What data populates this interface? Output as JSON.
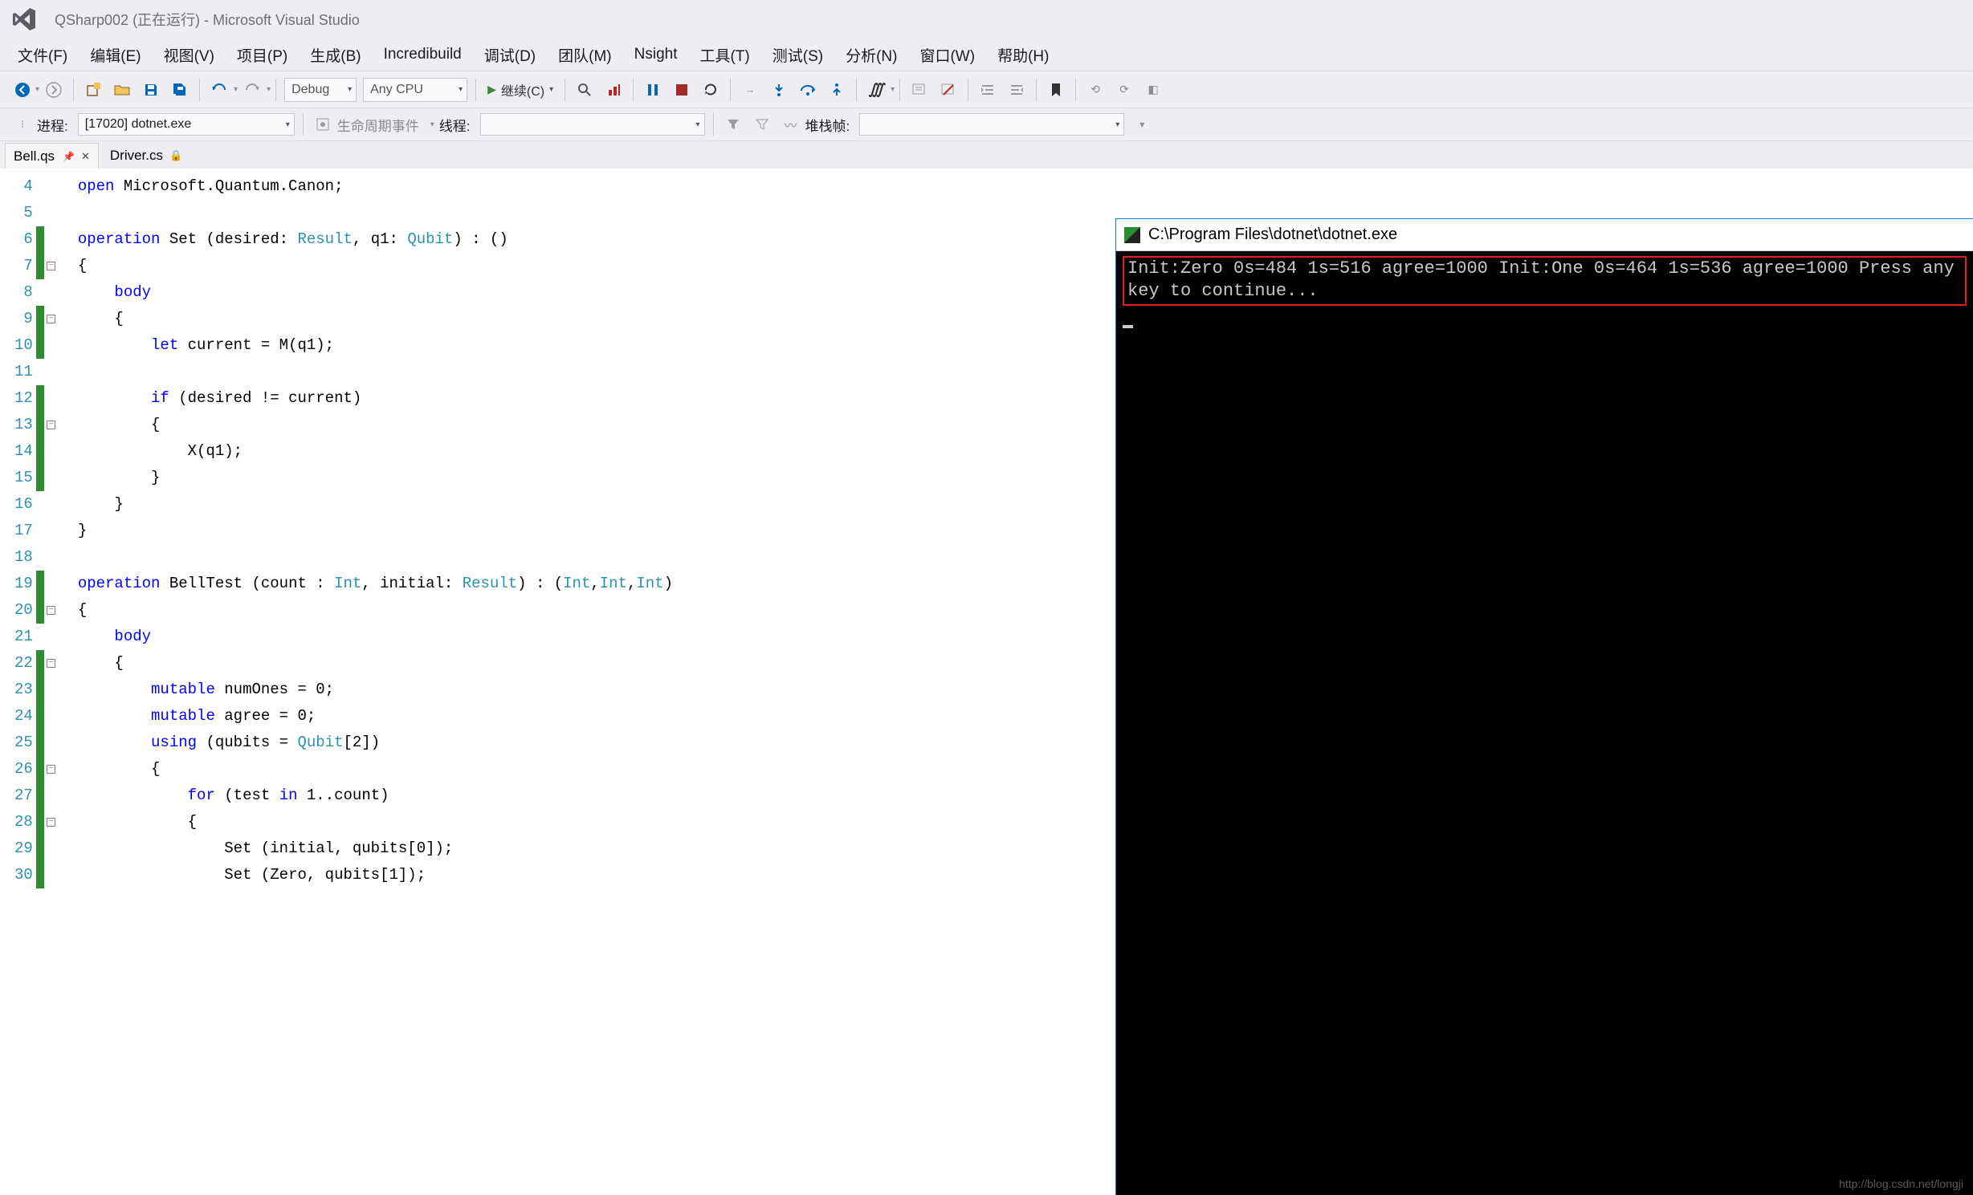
{
  "title": "QSharp002 (正在运行) - Microsoft Visual Studio",
  "menu": [
    "文件(F)",
    "编辑(E)",
    "视图(V)",
    "项目(P)",
    "生成(B)",
    "Incredibuild",
    "调试(D)",
    "团队(M)",
    "Nsight",
    "工具(T)",
    "测试(S)",
    "分析(N)",
    "窗口(W)",
    "帮助(H)"
  ],
  "toolbar": {
    "config": "Debug",
    "platform": "Any CPU",
    "continue": "继续(C)"
  },
  "toolbar2": {
    "process_label": "进程:",
    "process_value": "[17020] dotnet.exe",
    "lifecycle": "生命周期事件",
    "thread_label": "线程:",
    "stackframe_label": "堆栈帧:"
  },
  "tabs": {
    "active": "Bell.qs",
    "other": "Driver.cs"
  },
  "code": {
    "lines": [
      4,
      5,
      6,
      7,
      8,
      9,
      10,
      11,
      12,
      13,
      14,
      15,
      16,
      17,
      18,
      19,
      20,
      21,
      22,
      23,
      24,
      25,
      26,
      27,
      28,
      29,
      30
    ],
    "l4": {
      "a": "open",
      "b": " Microsoft.Quantum.Canon;"
    },
    "l6a": "operation",
    "l6b": " Set (desired: ",
    "l6c": "Result",
    "l6d": ", q1: ",
    "l6e": "Qubit",
    "l6f": ") : ()",
    "l7": "{",
    "l8": "body",
    "l9": "{",
    "l10a": "let",
    "l10b": " current = M(q1);",
    "l12a": "if",
    "l12b": " (desired != current)",
    "l13": "{",
    "l14": "X(q1);",
    "l15": "}",
    "l16": "}",
    "l17": "}",
    "l19a": "operation",
    "l19b": " BellTest (count : ",
    "l19c": "Int",
    "l19d": ", initial: ",
    "l19e": "Result",
    "l19f": ") : (",
    "l19g": "Int",
    "l19h": ",",
    "l19i": "Int",
    "l19j": ",",
    "l19k": "Int",
    "l19l": ")",
    "l20": "{",
    "l21": "body",
    "l22": "{",
    "l23a": "mutable",
    "l23b": " numOnes = 0;",
    "l24a": "mutable",
    "l24b": " agree = 0;",
    "l25a": "using",
    "l25b": " (qubits = ",
    "l25c": "Qubit",
    "l25d": "[2])",
    "l26": "{",
    "l27a": "for",
    "l27b": " (test ",
    "l27c": "in",
    "l27d": " 1..count)",
    "l28": "{",
    "l29": "Set (initial, qubits[0]);",
    "l30": "Set (Zero, qubits[1]);"
  },
  "console": {
    "title": "C:\\Program Files\\dotnet\\dotnet.exe",
    "line1": "Init:Zero 0s=484  1s=516  agree=1000",
    "line2": "Init:One  0s=464  1s=536  agree=1000",
    "line3": "Press any key to continue..."
  },
  "watermark": "http://blog.csdn.net/longji"
}
